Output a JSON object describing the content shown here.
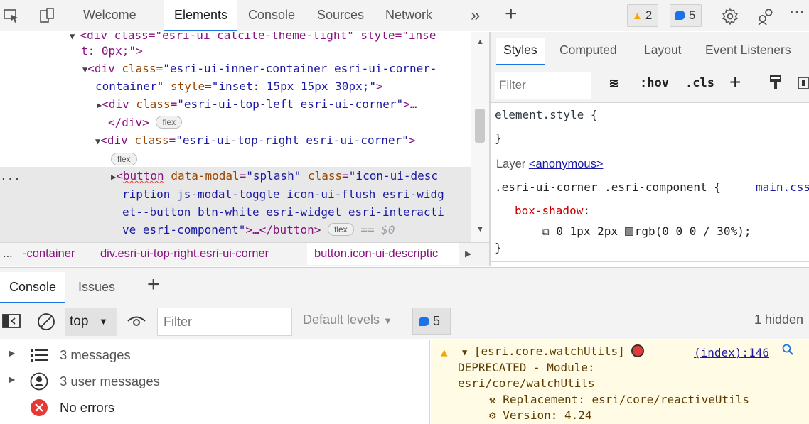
{
  "toolbar": {
    "tabs": [
      "Welcome",
      "Elements",
      "Console",
      "Sources",
      "Network"
    ],
    "active_tab": "Elements",
    "warnings_count": "2",
    "messages_count": "5",
    "more_tabs_icon": "double-chevron-icon",
    "add_tab_icon": "plus-icon"
  },
  "elements": {
    "lines": {
      "l0a": "<div class=\"esri-ui calcite-theme-light\" style=\"inse",
      "l0b": "t: 0px;\">",
      "l1_tag": "<div ",
      "l1_attr": "class",
      "l1_val": "\"esri-ui-inner-container esri-ui-corner-",
      "l2_val": "container\"",
      "l2_attr": "style",
      "l2_val2": "\"inset: 15px 15px 30px;\"",
      "l2_end": ">",
      "l3_tag": "<div ",
      "l3_attr": "class",
      "l3_val": "\"esri-ui-top-left esri-ui-corner\"",
      "l3_end": ">…",
      "l4_tag": "</div>",
      "l5_tag": "<div ",
      "l5_attr": "class",
      "l5_val": "\"esri-ui-top-right esri-ui-corner\"",
      "l5_end": ">",
      "l7_tag": "button",
      "l7_attr1": "data-modal",
      "l7_val1": "\"splash\"",
      "l7_attr2": "class",
      "l7_val2": "\"icon-ui-desc",
      "l8_val": "ription js-modal-toggle icon-ui-flush esri-widg",
      "l9_val": "et--button btn-white esri-widget esri-interacti",
      "l10_val": "ve esri-component\"",
      "l10_end": ">…</button>",
      "dollar": "== $0"
    },
    "flex_label": "flex",
    "gutter_dots": "..."
  },
  "breadcrumbs": {
    "dots": "...",
    "items": [
      "-container",
      "div.esri-ui-top-right.esri-ui-corner",
      "button.icon-ui-descriptic"
    ]
  },
  "styles": {
    "tabs": [
      "Styles",
      "Computed",
      "Layout",
      "Event Listeners"
    ],
    "active_tab": "Styles",
    "filter_placeholder": "Filter",
    "hov": ":hov",
    "cls": ".cls",
    "element_style": "element.style {",
    "close_brace": "}",
    "layer_label": "Layer",
    "layer_link": "<anonymous>",
    "rule_selector": ".esri-ui-corner .esri-component {",
    "rule_source": "main.css",
    "prop_name": "box-shadow",
    "prop_value": "0 1px 2px",
    "prop_color": "rgb(0 0 0 / 30%);"
  },
  "drawer": {
    "tabs": [
      "Console",
      "Issues"
    ],
    "active_tab": "Console"
  },
  "console": {
    "context": "top",
    "filter_placeholder": "Filter",
    "levels": "Default levels",
    "badge_count": "5",
    "hidden": "1 hidden",
    "sidebar": [
      "3 messages",
      "3 user messages",
      "No errors"
    ],
    "message": {
      "line1": "[esri.core.watchUtils]",
      "source": "(index):146",
      "line2": "DEPRECATED - Module:",
      "line3": "esri/core/watchUtils",
      "line4": "Replacement: esri/core/reactiveUtils",
      "line5": "Version: 4.24"
    }
  },
  "colors": {
    "accent": "#1a73e8",
    "warning": "#f2a60c",
    "error": "#e53935",
    "warning_bg": "#fffbe5"
  }
}
